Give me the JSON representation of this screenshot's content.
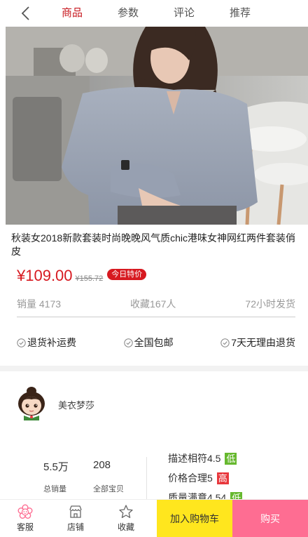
{
  "nav": {
    "back_icon": "chevron-left-icon",
    "tabs": [
      {
        "label": "商品",
        "active": true
      },
      {
        "label": "参数",
        "active": false
      },
      {
        "label": "评论",
        "active": false
      },
      {
        "label": "推荐",
        "active": false
      }
    ],
    "active_color": "#c7181f"
  },
  "product": {
    "title": "秋装女2018新款套装时尚晚晚风气质chic港味女神网红两件套装俏皮",
    "price": "¥109.00",
    "old_price": "¥155.72",
    "badge": "今日特价",
    "sales": "销量 4173",
    "favorites": "收藏167人",
    "shipping": "72小时发货",
    "price_color": "#d71920"
  },
  "services": [
    {
      "label": "退货补运费",
      "icon": "check-circle-icon"
    },
    {
      "label": "全国包邮",
      "icon": "check-circle-icon"
    },
    {
      "label": "7天无理由退货",
      "icon": "check-circle-icon"
    }
  ],
  "shop": {
    "name": "美衣梦莎",
    "avatar_icon": "shop-avatar",
    "total_sales_value": "5.5万",
    "total_sales_label": "总销量",
    "items_value": "208",
    "items_label": "全部宝贝",
    "ratings": [
      {
        "label": "描述相符4.5",
        "tag": "低",
        "tag_color": "#66b82e"
      },
      {
        "label": "价格合理5",
        "tag": "高",
        "tag_color": "#e8383d"
      },
      {
        "label": "质量满意4.54",
        "tag": "低",
        "tag_color": "#66b82e"
      }
    ]
  },
  "bottom": {
    "service": "客服",
    "store": "店铺",
    "favorite": "收藏",
    "add_to_cart": "加入购物车",
    "buy": "购买",
    "cart_color": "#ffe61e",
    "buy_color": "#fe6d92"
  }
}
